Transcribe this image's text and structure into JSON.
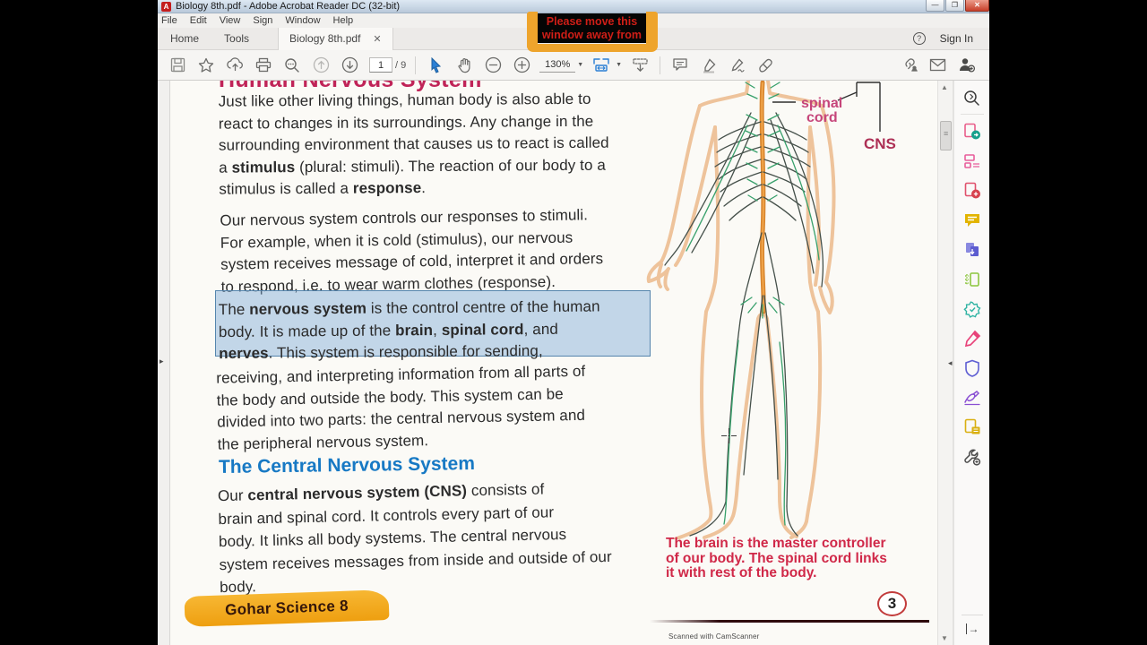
{
  "window": {
    "title": "Biology 8th.pdf - Adobe Acrobat Reader DC (32-bit)",
    "app_icon": "A",
    "buttons": {
      "minimize": "—",
      "restore": "❐",
      "close": "✕"
    }
  },
  "menu": {
    "items": [
      "File",
      "Edit",
      "View",
      "Sign",
      "Window",
      "Help"
    ]
  },
  "tabs": {
    "home": "Home",
    "tools": "Tools",
    "document": "Biology 8th.pdf",
    "close": "✕",
    "help": "?",
    "sign_in": "Sign In"
  },
  "toolbar": {
    "page_current": "1",
    "page_suffix": "/ 9",
    "zoom": "130%",
    "caret": "▼",
    "icons": [
      "save",
      "star",
      "share-cloud",
      "print",
      "search",
      "page-previous",
      "page-next",
      "select-tool",
      "hand-tool",
      "zoom-out",
      "zoom-in",
      "fit-width",
      "read-mode",
      "comment",
      "highlight",
      "fill-sign",
      "edit-pdf",
      "share-link",
      "email",
      "sign-in-person"
    ]
  },
  "overlay": {
    "line1": "Please move this",
    "line2": "window away from",
    "text_color": "#cf1e17",
    "frame_color": "#eea42c"
  },
  "right_panel": {
    "tools": [
      "search",
      "export-pdf",
      "organize-pages",
      "create-pdf",
      "comment",
      "combine-files",
      "compress-pdf",
      "convert-pdf",
      "fill-and-sign",
      "protect",
      "certificates",
      "stamp",
      "more-tools"
    ],
    "expand": "→"
  },
  "scrollbar": {
    "up": "▲",
    "down": "▼"
  },
  "doc": {
    "heading1": "Human Nervous System",
    "p1": [
      "Just like other  living things, human body is also able to",
      "react to changes in its surroundings. Any change in the",
      "surrounding environment that causes us to react is called",
      "a **stimulus** (plural: stimuli). The reaction of our body to a",
      "stimulus is called a **response**."
    ],
    "p2": [
      "Our nervous system controls our responses to stimuli.",
      "For example, when it is cold (stimulus), our nervous",
      "system receives message of cold, interpret it and orders",
      "to respond, i.e. to wear warm clothes (response)."
    ],
    "p3_selected": [
      "The **nervous system** is the control centre of the human",
      "body. It is made up of the **brain**, **spinal cord**, and",
      "**nerves**. This system is responsible for sending,"
    ],
    "p3_rest": [
      "receiving, and interpreting information from all parts of",
      "the body and outside the body. This system can be",
      "divided into two parts: the central nervous system and",
      "the peripheral nervous system."
    ],
    "heading2": "The Central Nervous System",
    "p4": [
      "Our **central nervous system (CNS)** consists of",
      "brain and spinal cord. It controls every part of our",
      "body. It links all body systems. The central nervous",
      "system receives messages from inside and outside of our",
      "body."
    ],
    "banner": "Gohar Science 8",
    "labels": {
      "spinal_line1": "spinal",
      "spinal_line2": "cord",
      "cns": "CNS"
    },
    "caption": [
      "The brain is the master controller",
      "of our body. The spinal cord links",
      "it with rest of the body."
    ],
    "page_number": "3",
    "scan_note": "Scanned with CamScanner"
  },
  "colors": {
    "heading1_red": "#c02458",
    "heading2_blue": "#1779c4",
    "caption_red": "#d02848",
    "selection_blue": "#7daad7",
    "banner_orange": "#f2a71f",
    "spine_orange": "#d8862f",
    "nerve_green": "#37a06b",
    "body_outline": "#eec39b"
  }
}
